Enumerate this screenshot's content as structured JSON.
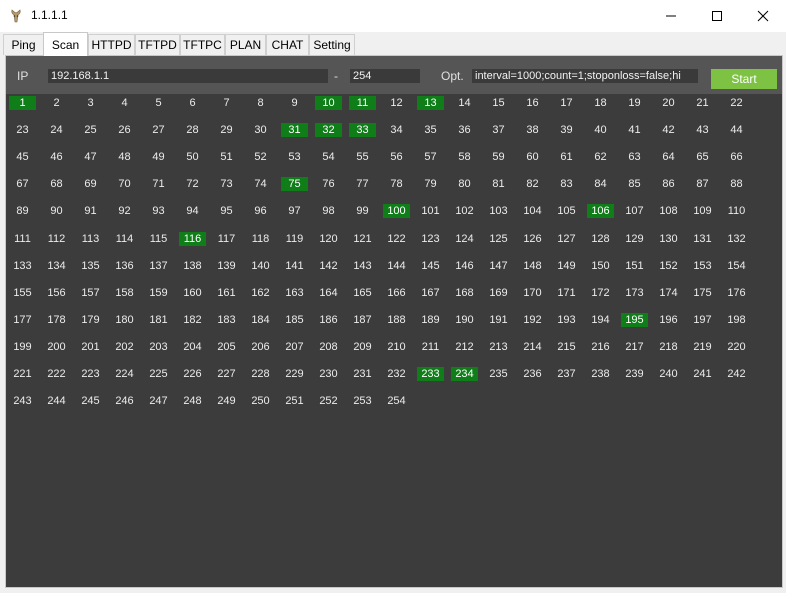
{
  "window": {
    "title": "1.1.1.1"
  },
  "tabs": [
    {
      "label": "Ping",
      "active": false
    },
    {
      "label": "Scan",
      "active": true
    },
    {
      "label": "HTTPD",
      "active": false
    },
    {
      "label": "TFTPD",
      "active": false
    },
    {
      "label": "TFTPC",
      "active": false
    },
    {
      "label": "PLAN",
      "active": false
    },
    {
      "label": "CHAT",
      "active": false
    },
    {
      "label": "Setting",
      "active": false
    }
  ],
  "scan": {
    "ip_label": "IP",
    "ip_start": "192.168.1.1",
    "range_sep": "-",
    "ip_end": "254",
    "opt_label": "Opt.",
    "opt_value": "interval=1000;count=1;stoponloss=false;hi",
    "start_label": "Start",
    "host_count": 254,
    "columns": 22,
    "online_hosts": [
      1,
      10,
      11,
      13,
      31,
      32,
      33,
      75,
      100,
      106,
      116,
      195,
      233,
      234
    ]
  },
  "colors": {
    "panel_bg": "#3c3c3c",
    "topbar_bg": "#555555",
    "online_bg": "#0f7d18",
    "start_button": "#7dc243"
  }
}
